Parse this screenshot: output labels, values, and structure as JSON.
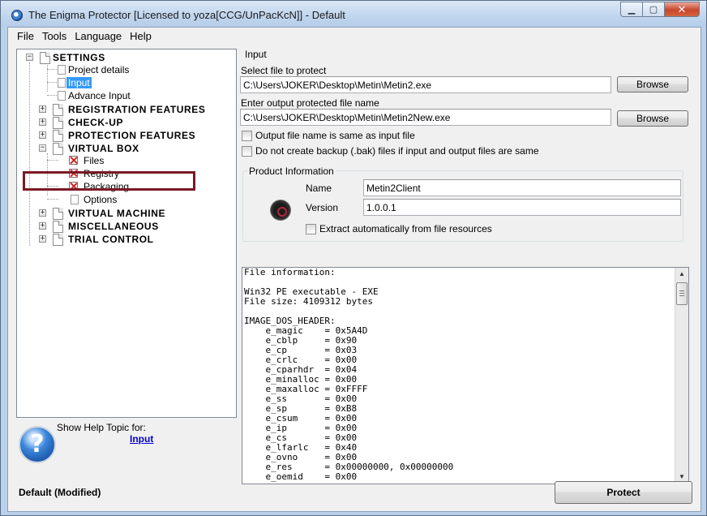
{
  "window": {
    "title": "The Enigma Protector [Licensed to yoza[CCG/UnPacKcN]] - Default",
    "caption_buttons": {
      "minimize": "▁",
      "maximize": "▢",
      "close": "✕"
    }
  },
  "menu": [
    "File",
    "Tools",
    "Language",
    "Help"
  ],
  "tree": {
    "settings": "SETTINGS",
    "project_details": "Project details",
    "input": "Input",
    "advance_input": "Advance Input",
    "registration_features": "REGISTRATION FEATURES",
    "check_up": "CHECK-UP",
    "protection_features": "PROTECTION FEATURES",
    "virtual_box": "VIRTUAL BOX",
    "files": "Files",
    "registry": "Registry",
    "packaging": "Packaging",
    "options": "Options",
    "virtual_machine": "VIRTUAL MACHINE",
    "miscellaneous": "MISCELLANEOUS",
    "trial_control": "TRIAL CONTROL",
    "expand_plus": "+",
    "collapse_minus": "−"
  },
  "help": {
    "icon": "question-icon",
    "glyph": "?",
    "caption": "Show Help Topic for:",
    "topic_link": "Input"
  },
  "status": "Default  (Modified)",
  "input_panel": {
    "group_title": "Input",
    "select_file_label": "Select file to protect",
    "select_file_value": "C:\\Users\\JOKER\\Desktop\\Metin\\Metin2.exe",
    "browse_label": "Browse",
    "output_file_label": "Enter output protected file name",
    "output_file_value": "C:\\Users\\JOKER\\Desktop\\Metin\\Metin2New.exe",
    "same_as_input_label": "Output file name is same as input file",
    "no_backup_label": "Do not create backup (.bak) files if input and output files are same"
  },
  "product_info": {
    "group_title": "Product Information",
    "name_label": "Name",
    "name_value": "Metin2Client",
    "version_label": "Version",
    "version_value": "1.0.0.1",
    "extract_label": "Extract automatically from file resources"
  },
  "file_info": {
    "lines": [
      "File information:",
      "",
      "Win32 PE executable - EXE",
      "File size: 4109312 bytes",
      "",
      "IMAGE_DOS_HEADER:",
      "    e_magic    = 0x5A4D",
      "    e_cblp     = 0x90",
      "    e_cp       = 0x03",
      "    e_crlc     = 0x00",
      "    e_cparhdr  = 0x04",
      "    e_minalloc = 0x00",
      "    e_maxalloc = 0xFFFF",
      "    e_ss       = 0x00",
      "    e_sp       = 0xB8",
      "    e_csum     = 0x00",
      "    e_ip       = 0x00",
      "    e_cs       = 0x00",
      "    e_lfarlc   = 0x40",
      "    e_ovno     = 0x00",
      "    e_res      = 0x00000000, 0x00000000",
      "    e_oemid    = 0x00"
    ],
    "scroll_up": "▲",
    "scroll_down": "▼"
  },
  "protect_label": "Protect"
}
